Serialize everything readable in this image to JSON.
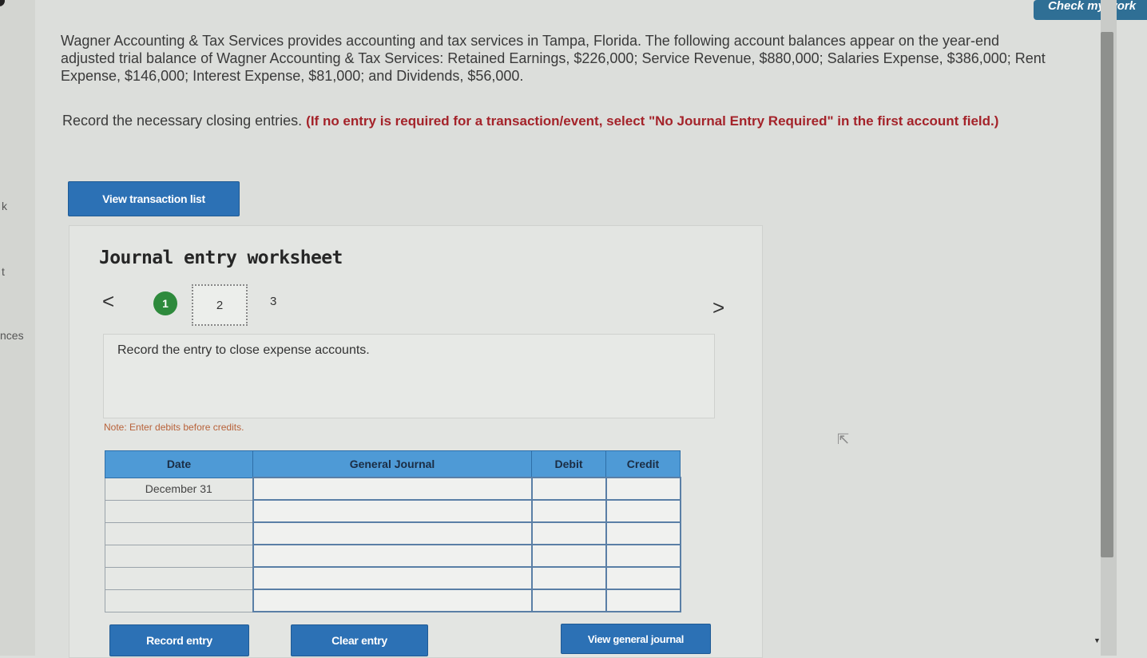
{
  "header": {
    "check_my_work": "Check my work"
  },
  "left_fragments": [
    "k",
    "t",
    "nces"
  ],
  "question": {
    "text": "Wagner Accounting & Tax Services provides accounting and tax services in Tampa, Florida. The following account balances appear on the year-end adjusted trial balance of Wagner Accounting & Tax Services: Retained Earnings, $226,000; Service Revenue, $880,000; Salaries Expense, $386,000; Rent Expense, $146,000; Interest Expense, $81,000; and Dividends, $56,000.",
    "instruction": "Record the necessary closing entries.",
    "instruction_red": "(If no entry is required for a transaction/event, select \"No Journal Entry Required\" in the first account field.)"
  },
  "buttons": {
    "view_transaction_list": "View transaction list",
    "record_entry": "Record entry",
    "clear_entry": "Clear entry",
    "view_general_journal": "View general journal"
  },
  "worksheet": {
    "title": "Journal entry worksheet",
    "prev_icon": "<",
    "next_icon": ">",
    "steps": [
      "1",
      "2",
      "3"
    ],
    "active_step": 2,
    "description": "Record the entry to close expense accounts.",
    "note": "Note: Enter debits before credits."
  },
  "table": {
    "headers": [
      "Date",
      "General Journal",
      "Debit",
      "Credit"
    ],
    "rows": [
      {
        "date": "December 31",
        "account": "",
        "debit": "",
        "credit": ""
      },
      {
        "date": "",
        "account": "",
        "debit": "",
        "credit": ""
      },
      {
        "date": "",
        "account": "",
        "debit": "",
        "credit": ""
      },
      {
        "date": "",
        "account": "",
        "debit": "",
        "credit": ""
      },
      {
        "date": "",
        "account": "",
        "debit": "",
        "credit": ""
      },
      {
        "date": "",
        "account": "",
        "debit": "",
        "credit": ""
      }
    ]
  },
  "colors": {
    "button_blue": "#2c71b5",
    "header_blue": "#4e9ad6",
    "step_green": "#2e8a3c",
    "instruction_red": "#a4232a"
  }
}
